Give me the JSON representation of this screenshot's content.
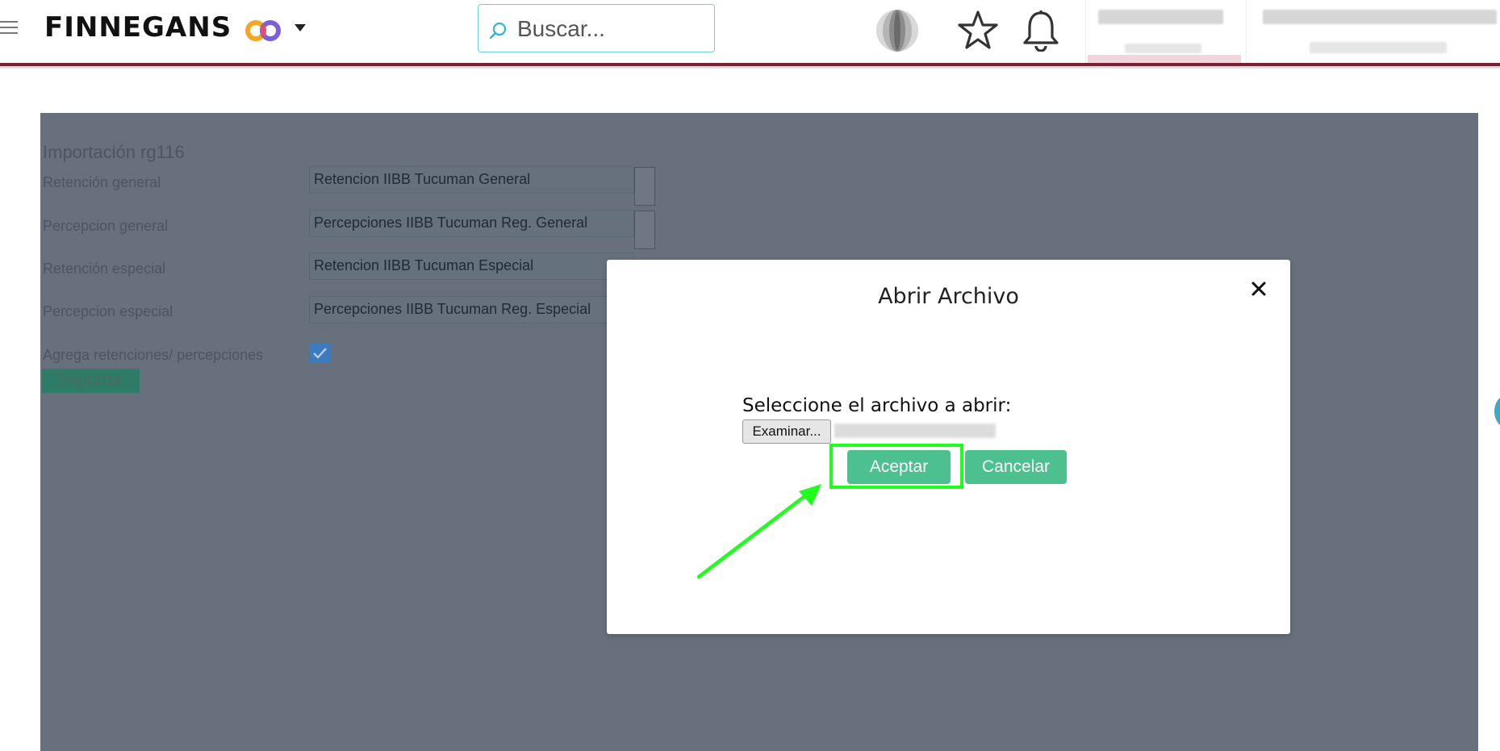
{
  "header": {
    "brand": "FINNEGANS",
    "search_placeholder": "Buscar..."
  },
  "form": {
    "title": "Importación rg116",
    "fields": [
      {
        "label": "Retención general",
        "value": "Retencion IIBB Tucuman General"
      },
      {
        "label": "Percepcion general",
        "value": "Percepciones IIBB Tucuman Reg. General"
      },
      {
        "label": "Retención especial",
        "value": "Retencion IIBB Tucuman Especial"
      },
      {
        "label": "Percepcion especial",
        "value": "Percepciones IIBB Tucuman Reg. Especial"
      }
    ],
    "checkbox_label": "Agrega retenciones/ percepciones",
    "checkbox_checked": true,
    "import_label": "Importar"
  },
  "modal": {
    "title": "Abrir Archivo",
    "prompt": "Seleccione el archivo a abrir:",
    "browse_label": "Examinar...",
    "accept_label": "Aceptar",
    "cancel_label": "Cancelar"
  },
  "colors": {
    "brand_line": "#7a1f35",
    "button_green": "#4cc08f",
    "highlight": "#1eff1e",
    "overlay": "#68707e"
  }
}
